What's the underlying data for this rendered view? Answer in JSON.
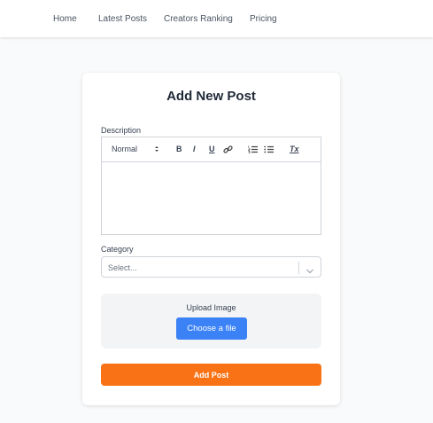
{
  "nav": {
    "items": [
      {
        "label": "Home"
      },
      {
        "label": "Latest Posts"
      },
      {
        "label": "Creators Ranking"
      },
      {
        "label": "Pricing"
      }
    ]
  },
  "form": {
    "title": "Add New Post",
    "description_label": "Description",
    "toolbar": {
      "heading_select": "Normal",
      "bold": "B",
      "italic": "I",
      "underline": "U",
      "clear_format": "Tx"
    },
    "category_label": "Category",
    "category_placeholder": "Select...",
    "upload_label": "Upload Image",
    "choose_file_label": "Choose a file",
    "submit_label": "Add Post"
  },
  "colors": {
    "primary_button": "#3b82f6",
    "submit_button": "#f97316"
  }
}
